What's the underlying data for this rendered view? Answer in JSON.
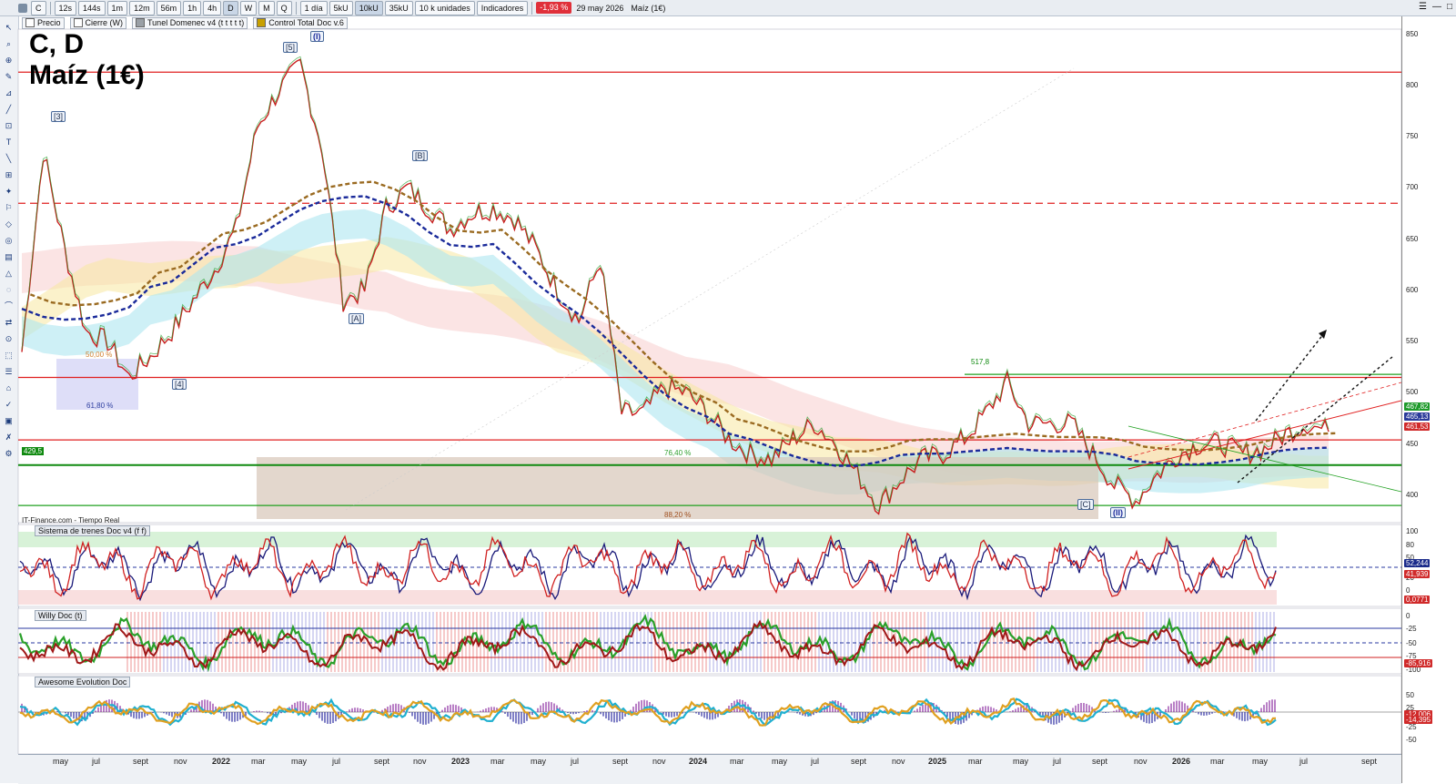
{
  "toolbar": {
    "symbol": "C",
    "timeframes": [
      "12s",
      "144s",
      "1m",
      "12m",
      "56m",
      "1h",
      "4h",
      "D",
      "W",
      "M",
      "Q"
    ],
    "active_timeframe": "D",
    "period": "1 día",
    "units": [
      "5kU",
      "10kU",
      "35kU"
    ],
    "active_unit": "10kU",
    "quantity": "10 k unidades",
    "indicators_label": "Indicadores",
    "change_badge": "-1,93 %",
    "date_text": "29 may 2026",
    "instrument_text": "Maíz (1€)"
  },
  "legend": {
    "items": [
      {
        "label": "Precio",
        "color": "#ffffff"
      },
      {
        "label": "Cierre (W)",
        "color": "#ffffff"
      },
      {
        "label": "Tunel Domenec v4 (t t t t t)",
        "color": "#9aa0a6"
      },
      {
        "label": "Control Total Doc v.6",
        "color": "#c8a000"
      }
    ]
  },
  "title": {
    "line1": "C, D",
    "line2": "Maíz (1€)"
  },
  "source": "IT-Finance.com - Tiempo Real",
  "panels": {
    "p1": "Sistema de trenes Doc v4 (f f)",
    "p2": "Willy Doc (t)",
    "p3": "Awesome Evolution Doc"
  },
  "waves": [
    {
      "label": "[3]",
      "big": false
    },
    {
      "label": "[5]",
      "big": false
    },
    {
      "label": "(I)",
      "big": true
    },
    {
      "label": "[B]",
      "big": false
    },
    {
      "label": "[A]",
      "big": false
    },
    {
      "label": "[4]",
      "big": false
    },
    {
      "label": "[C]",
      "big": false
    },
    {
      "label": "(II)",
      "big": true
    }
  ],
  "annotations": {
    "fib_50": "50,00 %",
    "fib_618": "61,80 %",
    "fib_764": "76,40 %",
    "fib_882": "88,20 %",
    "level_4295": "429,5",
    "level_5178": "517,8"
  },
  "right_axis": {
    "price_ticks": [
      "850",
      "800",
      "750",
      "700",
      "650",
      "600",
      "550",
      "500",
      "450",
      "400"
    ],
    "price_tags": [
      {
        "text": "467,82",
        "color": "#1e9a2a"
      },
      {
        "text": "465,13",
        "color": "#2a3a9a"
      },
      {
        "text": "461,53",
        "color": "#d02a2a"
      }
    ],
    "p1_ticks": [
      "100",
      "80",
      "50",
      "20",
      "0"
    ],
    "p1_tags": [
      {
        "text": "52,244",
        "color": "#1a2a8a"
      },
      {
        "text": "41,939",
        "color": "#d02a2a"
      },
      {
        "text": "0,0771",
        "color": "#d02a2a"
      }
    ],
    "p2_ticks": [
      "0",
      "-25",
      "-50",
      "-75",
      "-100"
    ],
    "p2_tags": [
      {
        "text": "-85,916",
        "color": "#d02a2a"
      }
    ],
    "p3_ticks": [
      "50",
      "25",
      "-25",
      "-50"
    ],
    "p3_tags": [
      {
        "text": "-12,006",
        "color": "#d02a2a"
      },
      {
        "text": "-14,395",
        "color": "#d02a2a"
      }
    ]
  },
  "x_axis": {
    "labels": [
      {
        "text": "may",
        "year": false
      },
      {
        "text": "jul",
        "year": false
      },
      {
        "text": "sept",
        "year": false
      },
      {
        "text": "nov",
        "year": false
      },
      {
        "text": "2022",
        "year": true
      },
      {
        "text": "mar",
        "year": false
      },
      {
        "text": "may",
        "year": false
      },
      {
        "text": "jul",
        "year": false
      },
      {
        "text": "sept",
        "year": false
      },
      {
        "text": "nov",
        "year": false
      },
      {
        "text": "2023",
        "year": true
      },
      {
        "text": "mar",
        "year": false
      },
      {
        "text": "may",
        "year": false
      },
      {
        "text": "jul",
        "year": false
      },
      {
        "text": "sept",
        "year": false
      },
      {
        "text": "nov",
        "year": false
      },
      {
        "text": "2024",
        "year": true
      },
      {
        "text": "mar",
        "year": false
      },
      {
        "text": "may",
        "year": false
      },
      {
        "text": "jul",
        "year": false
      },
      {
        "text": "sept",
        "year": false
      },
      {
        "text": "nov",
        "year": false
      },
      {
        "text": "2025",
        "year": true
      },
      {
        "text": "mar",
        "year": false
      },
      {
        "text": "may",
        "year": false
      },
      {
        "text": "jul",
        "year": false
      },
      {
        "text": "sept",
        "year": false
      },
      {
        "text": "nov",
        "year": false
      },
      {
        "text": "2026",
        "year": true
      },
      {
        "text": "mar",
        "year": false
      },
      {
        "text": "may",
        "year": false
      },
      {
        "text": "jul",
        "year": false
      },
      {
        "text": "sept",
        "year": false
      }
    ]
  },
  "chart_data": {
    "type": "line",
    "ylim": [
      375,
      855
    ],
    "x": [
      "2021-04",
      "2021-05",
      "2021-06",
      "2021-07",
      "2021-08",
      "2021-09",
      "2021-10",
      "2021-11",
      "2021-12",
      "2022-01",
      "2022-02",
      "2022-03",
      "2022-04",
      "2022-05",
      "2022-06",
      "2022-07",
      "2022-08",
      "2022-09",
      "2022-10",
      "2022-11",
      "2022-12",
      "2023-01",
      "2023-02",
      "2023-03",
      "2023-04",
      "2023-05",
      "2023-06",
      "2023-07",
      "2023-08",
      "2023-09",
      "2023-10",
      "2023-11",
      "2023-12",
      "2024-01",
      "2024-02",
      "2024-03",
      "2024-04",
      "2024-05",
      "2024-06",
      "2024-07",
      "2024-08",
      "2024-09",
      "2024-10",
      "2024-11",
      "2024-12",
      "2025-01",
      "2025-02",
      "2025-03",
      "2025-04",
      "2025-05",
      "2025-06",
      "2025-07",
      "2025-08",
      "2025-09",
      "2025-10",
      "2025-11",
      "2025-12",
      "2026-01",
      "2026-02",
      "2026-03",
      "2026-04",
      "2026-05"
    ],
    "series": [
      {
        "values": [
          540,
          735,
          640,
          560,
          550,
          515,
          535,
          560,
          590,
          620,
          660,
          760,
          795,
          820,
          740,
          590,
          600,
          680,
          700,
          680,
          660,
          675,
          680,
          670,
          640,
          600,
          570,
          630,
          480,
          480,
          505,
          500,
          480,
          455,
          440,
          435,
          455,
          470,
          450,
          420,
          390,
          415,
          435,
          440,
          455,
          480,
          510,
          470,
          470,
          470,
          440,
          410,
          395,
          420,
          440,
          450,
          450,
          440,
          445,
          460,
          470,
          462
        ],
        "color": "#c02020"
      }
    ],
    "horizontal_levels": [
      {
        "value": 813,
        "color": "#e02020",
        "style": "solid"
      },
      {
        "value": 685,
        "color": "#e02020",
        "style": "dashed"
      },
      {
        "value": 515,
        "color": "#e02020",
        "style": "solid"
      },
      {
        "value": 454,
        "color": "#e02020",
        "style": "solid"
      },
      {
        "value": 429.5,
        "color": "#108a10",
        "style": "solid"
      },
      {
        "value": 390,
        "color": "#20a020",
        "style": "solid"
      },
      {
        "value": 518,
        "color": "#20a020",
        "style": "solid"
      }
    ]
  }
}
